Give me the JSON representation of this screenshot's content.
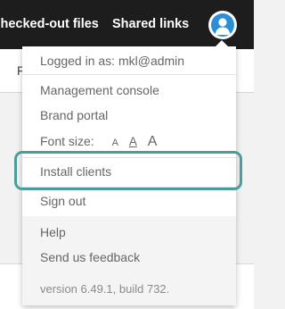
{
  "topbar": {
    "nav": [
      {
        "label": "Checked-out files"
      },
      {
        "label": "Shared links"
      }
    ],
    "avatar": "user-avatar-icon"
  },
  "subbar": {
    "first_letter": "F"
  },
  "user_menu": {
    "logged_in_as": "Logged in as: mkl@admin",
    "management_console": "Management console",
    "brand_portal": "Brand portal",
    "font_size_label": "Font size:",
    "font_sizes": [
      "A",
      "A",
      "A"
    ],
    "install_clients": "Install clients",
    "sign_out": "Sign out",
    "help": "Help",
    "send_feedback": "Send us feedback",
    "version": "version 6.49.1, build 732."
  },
  "colors": {
    "topbar": "#1d1d1d",
    "avatar": "#2a8fd6",
    "highlight": "#4a9d9c"
  }
}
